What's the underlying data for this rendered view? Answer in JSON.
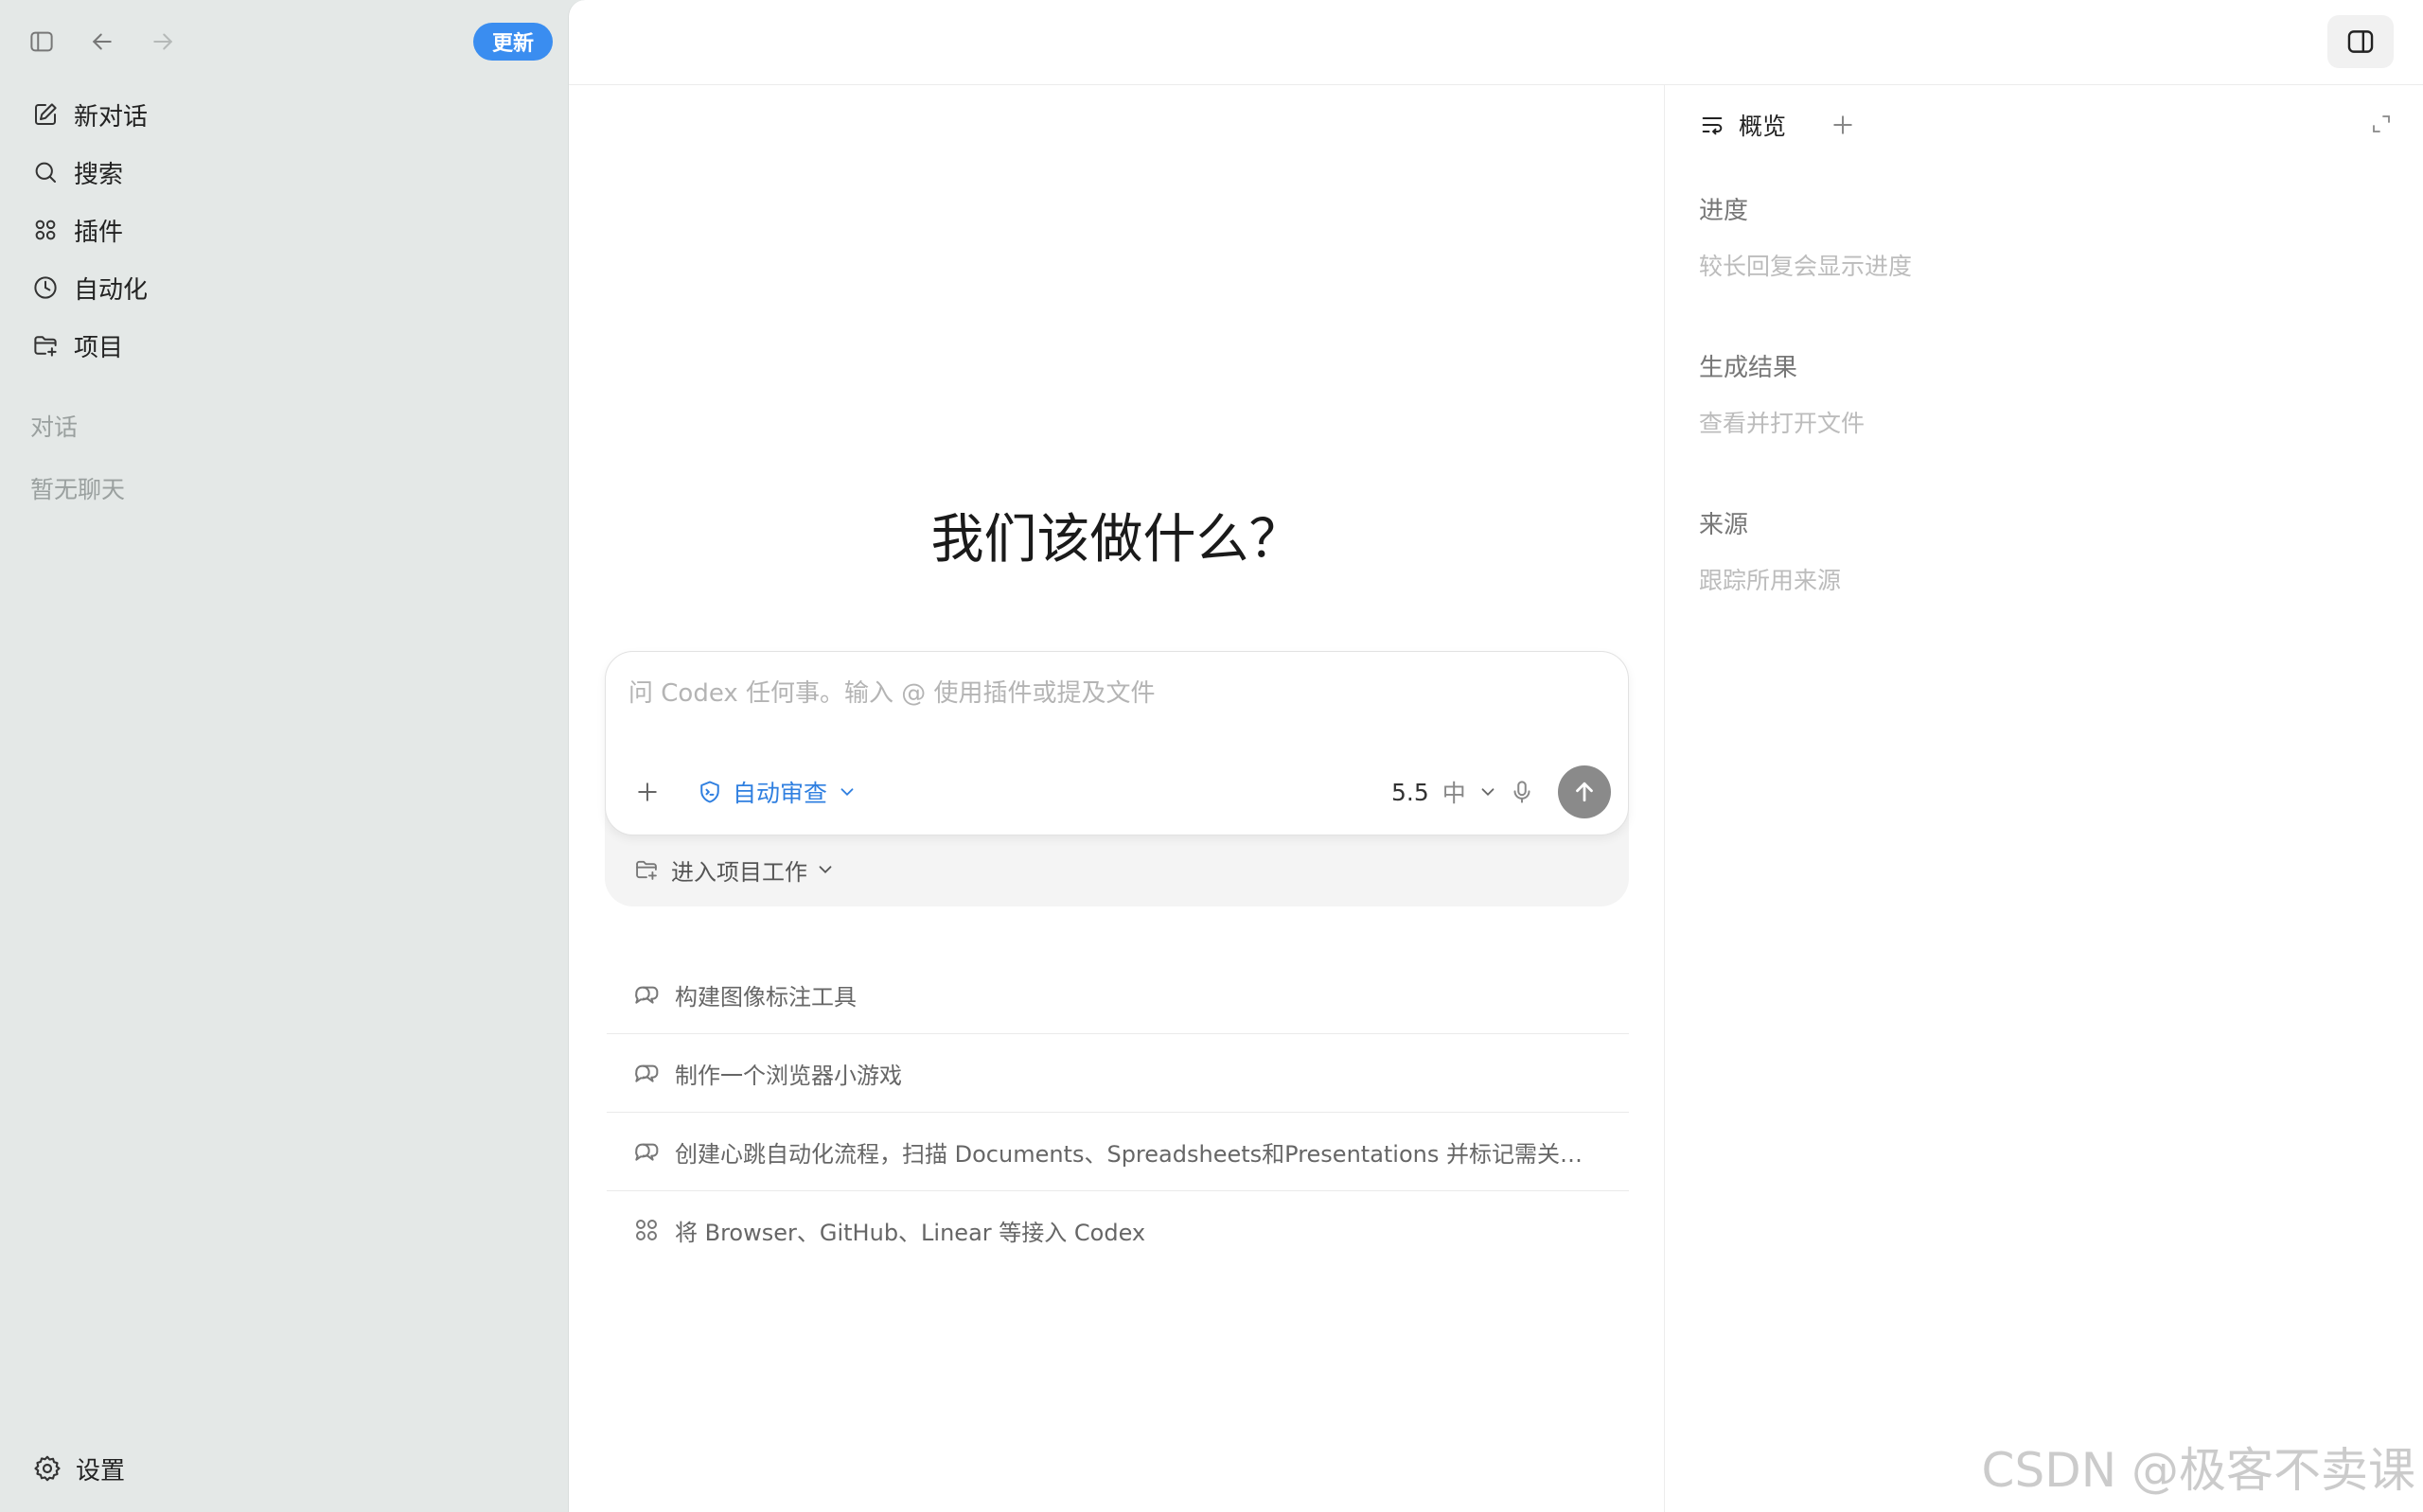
{
  "sidebar": {
    "update_label": "更新",
    "nav": [
      {
        "label": "新对话",
        "icon": "edit-icon"
      },
      {
        "label": "搜索",
        "icon": "search-icon"
      },
      {
        "label": "插件",
        "icon": "grid-icon"
      },
      {
        "label": "自动化",
        "icon": "clock-icon"
      },
      {
        "label": "项目",
        "icon": "folder-plus-icon"
      }
    ],
    "section_title": "对话",
    "empty_text": "暂无聊天",
    "settings_label": "设置"
  },
  "main": {
    "headline": "我们该做什么？",
    "composer": {
      "placeholder": "问 Codex 任何事。输入 @ 使用插件或提及文件",
      "mode_label": "自动审查",
      "model": "5.5",
      "effort": "中"
    },
    "project_work_label": "进入项目工作",
    "suggestions": [
      {
        "label": "构建图像标注工具",
        "icon": "chat-bubbles-icon"
      },
      {
        "label": "制作一个浏览器小游戏",
        "icon": "chat-bubbles-icon"
      },
      {
        "label": "创建心跳自动化流程，扫描 Documents、Spreadsheets和Presentations 并标记需关…",
        "icon": "chat-bubbles-icon"
      },
      {
        "label": "将 Browser、GitHub、Linear 等接入 Codex",
        "icon": "grid-icon"
      }
    ]
  },
  "right_panel": {
    "tab_label": "概览",
    "sections": [
      {
        "title": "进度",
        "desc": "较长回复会显示进度"
      },
      {
        "title": "生成结果",
        "desc": "查看并打开文件"
      },
      {
        "title": "来源",
        "desc": "跟踪所用来源"
      }
    ]
  },
  "watermark": "CSDN @极客不卖课",
  "colors": {
    "accent": "#3a8df0",
    "sidebar_bg": "#e4e8e7",
    "send_button": "#8a8a8a"
  }
}
